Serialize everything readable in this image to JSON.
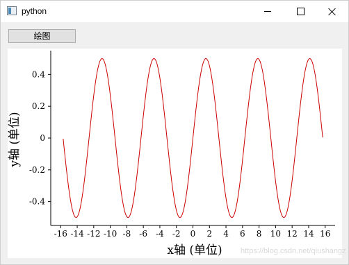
{
  "window": {
    "title": "python"
  },
  "toolbar": {
    "plot_button_label": "绘图"
  },
  "chart_data": {
    "type": "line",
    "function": "0.5*sin(x)",
    "x_range": [
      -15.7,
      15.7
    ],
    "xlim": [
      -17.2,
      17.2
    ],
    "ylim": [
      -0.55,
      0.55
    ],
    "xlabel": "x轴 (单位)",
    "ylabel": "y轴 (单位)",
    "xticks": [
      -16,
      -14,
      -12,
      -10,
      -8,
      -6,
      -4,
      -2,
      0,
      2,
      4,
      6,
      8,
      10,
      12,
      14,
      16
    ],
    "xtick_labels": [
      "-16",
      "-14",
      "-12",
      "-10",
      "-8",
      "-6",
      "-4",
      "-2",
      "0",
      "2",
      "4",
      "6",
      "8",
      "10",
      "12",
      "14",
      "16"
    ],
    "yticks": [
      -0.4,
      -0.2,
      0,
      0.2,
      0.4
    ],
    "ytick_labels": [
      "-0.4",
      "-0.2",
      "0",
      "0.2",
      "0.4"
    ],
    "line_color": "#cc0000",
    "grid": false
  },
  "watermark": {
    "text": "https://blog.csdn.net/qiushangz"
  }
}
